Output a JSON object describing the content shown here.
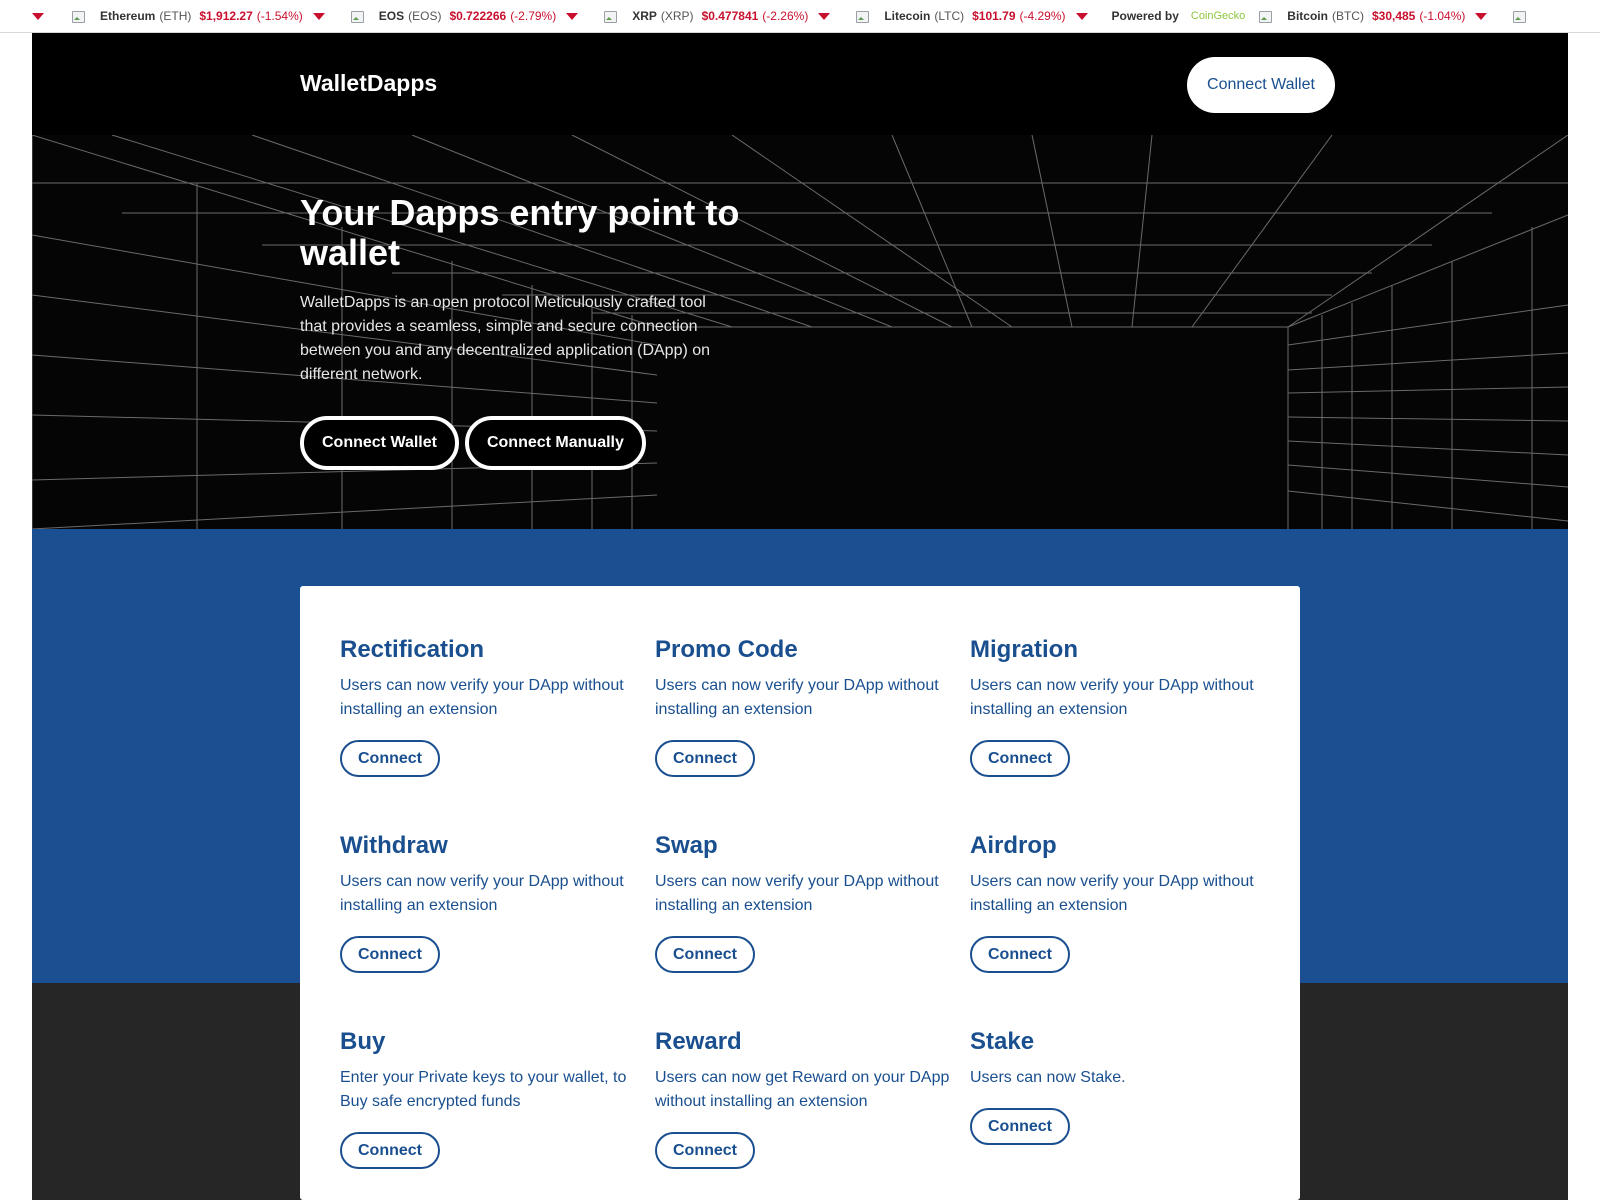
{
  "ticker": {
    "items": [
      {
        "name": "Ethereum",
        "symbol": "(ETH)",
        "price": "$1,912.27",
        "change": "(-1.54%)"
      },
      {
        "name": "EOS",
        "symbol": "(EOS)",
        "price": "$0.722266",
        "change": "(-2.79%)"
      },
      {
        "name": "XRP",
        "symbol": "(XRP)",
        "price": "$0.477841",
        "change": "(-2.26%)"
      },
      {
        "name": "Litecoin",
        "symbol": "(LTC)",
        "price": "$101.79",
        "change": "(-4.29%)"
      },
      {
        "name": "Bitcoin",
        "symbol": "(BTC)",
        "price": "$30,485",
        "change": "(-1.04%)"
      }
    ],
    "powered_by_label": "Powered by",
    "powered_by_brand": "CoinGecko",
    "change_color": "#c8102e",
    "brand_color": "#8dc63f"
  },
  "header": {
    "brand": "WalletDapps",
    "connect_label": "Connect Wallet"
  },
  "hero": {
    "title": "Your Dapps entry point to wallet",
    "description": "WalletDapps is an open protocol Meticulously crafted tool that provides a seamless, simple and secure connection between you and any decentralized application (DApp) on different network.",
    "connect_wallet_label": "Connect Wallet",
    "connect_manually_label": "Connect Manually"
  },
  "colors": {
    "accent": "#1a4f8f",
    "blue_band": "#1a5091",
    "dark_band": "#262626",
    "header_bg": "#000000"
  },
  "features": [
    {
      "title": "Rectification",
      "description": "Users can now verify your DApp without installing an extension",
      "button": "Connect"
    },
    {
      "title": "Promo Code",
      "description": "Users can now verify your DApp without installing an extension",
      "button": "Connect"
    },
    {
      "title": "Migration",
      "description": "Users can now verify your DApp without installing an extension",
      "button": "Connect"
    },
    {
      "title": "Withdraw",
      "description": "Users can now verify your DApp without installing an extension",
      "button": "Connect"
    },
    {
      "title": "Swap",
      "description": "Users can now verify your DApp without installing an extension",
      "button": "Connect"
    },
    {
      "title": "Airdrop",
      "description": "Users can now verify your DApp without installing an extension",
      "button": "Connect"
    },
    {
      "title": "Buy",
      "description": "Enter your Private keys to your wallet, to Buy safe encrypted funds",
      "button": "Connect"
    },
    {
      "title": "Reward",
      "description": "Users can now get Reward on your DApp without installing an extension",
      "button": "Connect"
    },
    {
      "title": "Stake",
      "description": "Users can now Stake.",
      "button": "Connect"
    }
  ]
}
